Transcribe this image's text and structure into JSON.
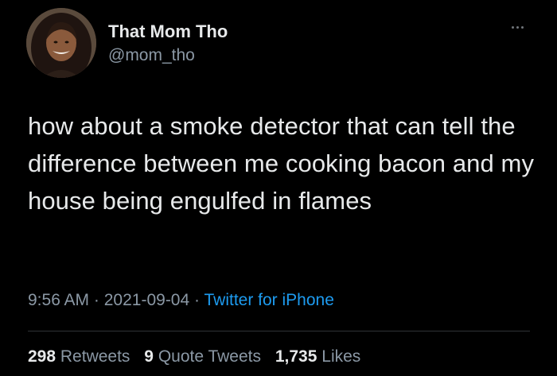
{
  "tweet": {
    "author": {
      "display_name": "That Mom Tho",
      "handle": "@mom_tho",
      "avatar_icon": "profile-photo"
    },
    "more_icon": "more-horizontal-icon",
    "text": "how about a smoke detector that can tell the difference between me cooking bacon and my house being engulfed in flames",
    "time": "9:56 AM",
    "date": "2021-09-04",
    "separator": "·",
    "source": "Twitter for iPhone",
    "stats": {
      "retweets_count": "298",
      "retweets_label": "Retweets",
      "quotes_count": "9",
      "quotes_label": "Quote Tweets",
      "likes_count": "1,735",
      "likes_label": "Likes"
    }
  },
  "colors": {
    "background": "#000000",
    "primary_text": "#e7e9ea",
    "secondary_text": "#8b98a5",
    "link": "#1d9bf0",
    "divider": "#2f3336"
  }
}
